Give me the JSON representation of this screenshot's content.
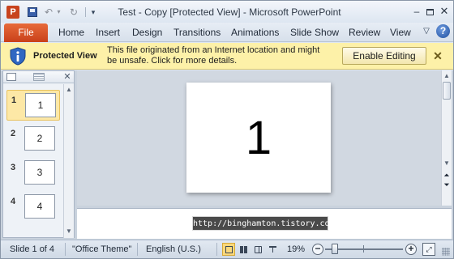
{
  "app": {
    "title": "Test - Copy [Protected View]  -  Microsoft PowerPoint",
    "icon_letter": "P",
    "window_controls": {
      "minimize": "–",
      "close": "✕"
    }
  },
  "quick_access": {
    "undo": "↶",
    "undo_drop": "▾",
    "redo": "↻",
    "customize": "▾"
  },
  "ribbon": {
    "file_tab": "File",
    "tabs": [
      "Home",
      "Insert",
      "Design",
      "Transitions",
      "Animations",
      "Slide Show",
      "Review",
      "View"
    ],
    "minimize_glyph": "▽",
    "help": "?"
  },
  "protected_view": {
    "title": "Protected View",
    "message": "This file originated from an Internet location and might be unsafe. Click for more details.",
    "button": "Enable Editing",
    "close": "✕"
  },
  "slides_pane": {
    "close": "✕",
    "slides": [
      {
        "number": "1",
        "text": "1",
        "selected": true
      },
      {
        "number": "2",
        "text": "2",
        "selected": false
      },
      {
        "number": "3",
        "text": "3",
        "selected": false
      },
      {
        "number": "4",
        "text": "4",
        "selected": false
      }
    ],
    "scroll_up": "▲",
    "scroll_down": "▼"
  },
  "canvas": {
    "slide_text": "1",
    "scroll_up": "▲",
    "scroll_down": "▼",
    "prev_slide": "⏶",
    "next_slide": "⏷"
  },
  "notes": {
    "watermark": "http://binghamton.tistory.com"
  },
  "status_bar": {
    "slide_info": "Slide 1 of 4",
    "theme": "\"Office Theme\"",
    "language": "English (U.S.)",
    "active_view": "normal",
    "zoom": "19%",
    "zoom_minus": "−",
    "zoom_plus": "+",
    "fit": "⤢",
    "zoom_level_fraction": 0.12
  },
  "colors": {
    "file_tab": "#d1481f",
    "protected_bar": "#fdf1a8",
    "selected_thumb": "#fde8a6",
    "active_view_button": "#fbd87a"
  }
}
